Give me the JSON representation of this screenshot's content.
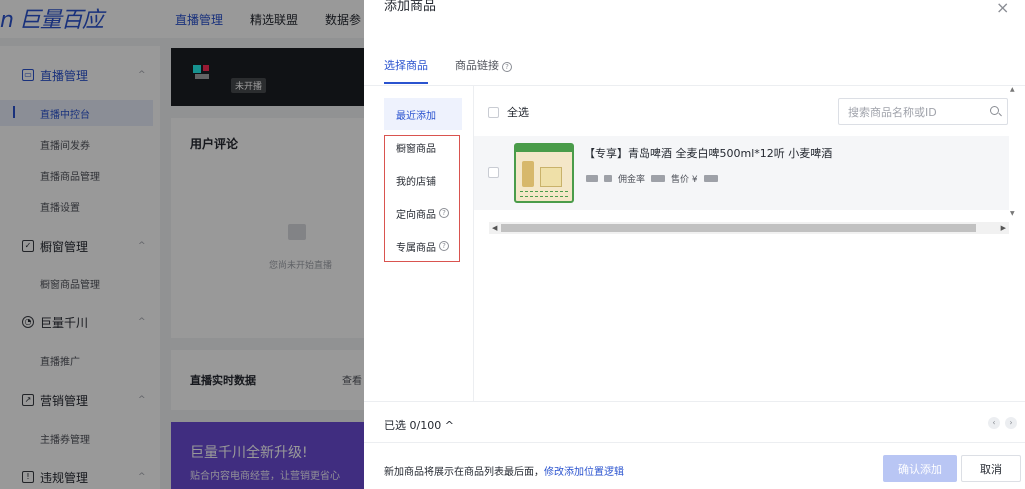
{
  "app": {
    "logo": "n 巨量百应"
  },
  "topnav": [
    "直播管理",
    "精选联盟",
    "数据参"
  ],
  "sidebar": {
    "groups": [
      {
        "label": "直播管理",
        "icon": "live-icon"
      },
      {
        "label": "橱窗管理",
        "icon": "showcase-icon"
      },
      {
        "label": "巨量千川",
        "icon": "qianchuan-icon"
      },
      {
        "label": "营销管理",
        "icon": "marketing-icon"
      },
      {
        "label": "违规管理",
        "icon": "violation-icon"
      }
    ],
    "items": [
      "直播中控台",
      "直播间发券",
      "直播商品管理",
      "直播设置",
      "橱窗商品管理",
      "直播推广",
      "主播券管理"
    ]
  },
  "main": {
    "live_status": "未开播",
    "comments_title": "用户评论",
    "not_started_text": "您尚未开始直播",
    "realtime_title": "直播实时数据",
    "view_more": "查看",
    "promo_title": "巨量千川全新升级!",
    "promo_text": "贴合内容电商经营，让营销更省心"
  },
  "drawer": {
    "title": "添加商品",
    "tabs": [
      "选择商品",
      "商品链接"
    ],
    "categories": [
      "最近添加",
      "橱窗商品",
      "我的店铺",
      "定向商品",
      "专属商品"
    ],
    "select_all": "全选",
    "search_placeholder": "搜索商品名称或ID",
    "product": {
      "title": "【专享】青岛啤酒 全麦白啤500ml*12听 小麦啤酒",
      "commission_label": "佣金率",
      "price_label": "售价 ¥"
    },
    "selected_count": "已选 0/100",
    "note_text": "新加商品将展示在商品列表最后面，",
    "note_link": "修改添加位置逻辑",
    "confirm": "确认添加",
    "cancel": "取消"
  },
  "colors": {
    "accent": "#2a53cf",
    "highlight_box": "#d9534f",
    "promo": "#6b4cd6"
  }
}
